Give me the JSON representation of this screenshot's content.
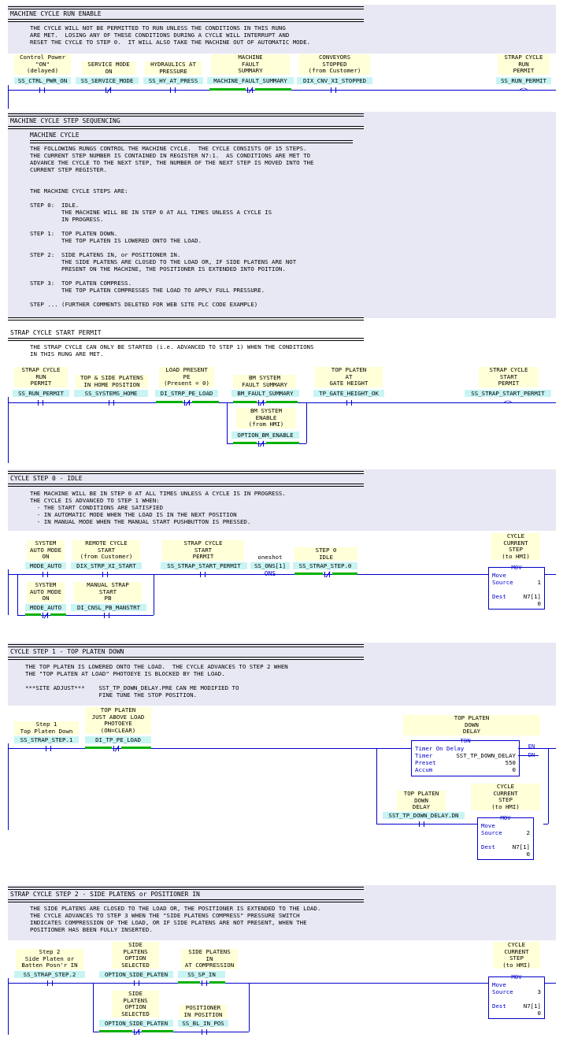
{
  "colors": {
    "wire": "#0000cc",
    "label_bg": "#ffffd8",
    "tag_bg": "#c8f4f4",
    "energized": "#00b000",
    "band": "#e8e8f4"
  },
  "s1": {
    "title": "MACHINE CYCLE RUN ENABLE",
    "comment": "THE CYCLE WILL NOT BE PERMITTED TO RUN UNLESS THE CONDITIONS IN THIS RUNG\nARE MET.  LOSING ANY OF THESE CONDITIONS DURING A CYCLE WILL INTERRUPT AND\nRESET THE CYCLE TO STEP 0.  IT WILL ALSO TAKE THE MACHINE OUT OF AUTOMATIC MODE.",
    "e1": {
      "label": "Control Power\n\"ON\"\n(delayed)",
      "tag": "SS_CTRL_PWR_ON"
    },
    "e2": {
      "label": "SERVICE MODE\nON",
      "tag": "SS_SERVICE_MODE"
    },
    "e3": {
      "label": "HYDRAULICS AT\nPRESSURE",
      "tag": "SS_HY_AT_PRESS"
    },
    "e4": {
      "label": "MACHINE\nFAULT\nSUMMARY",
      "tag": "MACHINE_FAULT_SUMMARY"
    },
    "e5": {
      "label": "CONVEYORS\nSTOPPED\n(from Customer)",
      "tag": "DIX_CNV_XI_STOPPED"
    },
    "out": {
      "label": "STRAP CYCLE\nRUN\nPERMIT",
      "tag": "SS_RUN_PERMIT"
    }
  },
  "s2": {
    "title": "MACHINE CYCLE STEP SEQUENCING",
    "sub": "MACHINE CYCLE",
    "comment": "THE FOLLOWING RUNGS CONTROL THE MACHINE CYCLE.  THE CYCLE CONSISTS OF 15 STEPS.\nTHE CURRENT STEP NUMBER IS CONTAINED IN REGISTER N7:1.  AS CONDITIONS ARE MET TO\nADVANCE THE CYCLE TO THE NEXT STEP, THE NUMBER OF THE NEXT STEP IS MOVED INTO THE\nCURRENT STEP REGISTER.\n\n\nTHE MACHINE CYCLE STEPS ARE:\n\nSTEP 0:  IDLE.\n         THE MACHINE WILL BE IN STEP 0 AT ALL TIMES UNLESS A CYCLE IS\n         IN PROGRESS.\n\nSTEP 1:  TOP PLATEN DOWN.\n         THE TOP PLATEN IS LOWERED ONTO THE LOAD.\n\nSTEP 2:  SIDE PLATENS IN, or POSITIONER IN.\n         THE SIDE PLATENS ARE CLOSED TO THE LOAD OR, IF SIDE PLATENS ARE NOT\n         PRESENT ON THE MACHINE, THE POSITIONER IS EXTENDED INTO POITION.\n\nSTEP 3:  TOP PLATEN COMPRESS.\n         THE TOP PLATEN COMPRESSES THE LOAD TO APPLY FULL PRESSURE.\n\nSTEP ... (FURTHER COMMENTS DELETED FOR WEB SITE PLC CODE EXAMPLE)"
  },
  "s3": {
    "title": "STRAP CYCLE START PERMIT",
    "comment": "THE STRAP CYCLE CAN ONLY BE STARTED (i.e. ADVANCED TO STEP 1) WHEN THE CONDITIONS\nIN THIS RUNG ARE MET.",
    "e1": {
      "label": "STRAP CYCLE\nRUN\nPERMIT",
      "tag": "SS_RUN_PERMIT"
    },
    "e2": {
      "label": "TOP & SIDE PLATENS\nIN HOME POSITION",
      "tag": "SS_SYSTEMS_HOME"
    },
    "e3": {
      "label": "LOAD PRESENT\nPE\n(Present = 0)",
      "tag": "DI_STRP_PE_LOAD"
    },
    "e4": {
      "label": "BM SYSTEM\nFAULT SUMMARY",
      "tag": "BM_FAULT_SUMMARY"
    },
    "e4b": {
      "label": "BM SYSTEM\nENABLE\n(from HMI)",
      "tag": "OPTION_BM_ENABLE"
    },
    "e5": {
      "label": "TOP PLATEN\nAT\nGATE HEIGHT",
      "tag": "TP_GATE_HEIGHT_OK"
    },
    "out": {
      "label": "STRAP CYCLE\nSTART\nPERMIT",
      "tag": "SS_STRAP_START_PERMIT"
    }
  },
  "s4": {
    "title": "CYCLE STEP 0 - IDLE",
    "comment": "THE MACHINE WILL BE IN STEP 0 AT ALL TIMES UNLESS A CYCLE IS IN PROGRESS.\nTHE CYCLE IS ADVANCED TO STEP 1 WHEN:\n  - THE START CONDITIONS ARE SATISFIED\n  - IN AUTOMATIC MODE WHEN THE LOAD IS IN THE NEXT POSITION\n  - IN MANUAL MODE WHEN THE MANUAL START PUSHBUTTON IS PRESSED.",
    "e1": {
      "label": "SYSTEM\nAUTO MODE\nON",
      "tag": "MODE_AUTO"
    },
    "e2": {
      "label": "REMOTE CYCLE\nSTART\n(from Customer)",
      "tag": "DIX_STRP_XI_START"
    },
    "e1b": {
      "label": "SYSTEM\nAUTO MODE\nON",
      "tag": "MODE_AUTO"
    },
    "e2b": {
      "label": "MANUAL STRAP\nSTART\nPB",
      "tag": "DI_CNSL_PB_MANSTRT"
    },
    "e3": {
      "label": "STRAP CYCLE\nSTART\nPERMIT",
      "tag": "SS_STRAP_START_PERMIT"
    },
    "os": {
      "label": "oneshot",
      "tag": "SS_ONS[1]",
      "sym": "ONS"
    },
    "e4": {
      "label": "STEP 0\nIDLE",
      "tag": "SS_STRAP_STEP.0"
    },
    "mov": {
      "label": "CYCLE\nCURRENT\nSTEP\n(to HMI)",
      "hdr": "MOV",
      "move": "Move",
      "src_l": "Source",
      "src_v": "1",
      "dst_l": "Dest",
      "dst_v": "N7[1]",
      "dst_val": "0"
    }
  },
  "s5": {
    "title": "CYCLE STEP 1 - TOP PLATEN DOWN",
    "comment": "THE TOP PLATEN IS LOWERED ONTO THE LOAD.  THE CYCLE ADVANCES TO STEP 2 WHEN\nTHE \"TOP PLATEN AT LOAD\" PHOTOEYE IS BLOCKED BY THE LOAD.\n\n***SITE ADJUST***    SST_TP_DOWN_DELAY.PRE CAN ME MODIFIED TO\n                     FINE TUNE THE STOP POSITION.",
    "e1": {
      "label": "Step 1\nTop Platen Down",
      "tag": "SS_STRAP_STEP.1"
    },
    "e2": {
      "label": "TOP PLATEN\nJUST ABOVE LOAD\nPHOTOEYE\n(ON=CLEAR)",
      "tag": "DI_TP_PE_LOAD"
    },
    "ton": {
      "label": "TOP PLATEN\nDOWN\nDELAY",
      "hdr": "TON",
      "name": "Timer On Delay",
      "t_l": "Timer",
      "t_v": "SST_TP_DOWN_DELAY",
      "p_l": "Preset",
      "p_v": "550",
      "a_l": "Accum",
      "a_v": "0",
      "en": "EN",
      "dn": "DN"
    },
    "e3": {
      "label": "TOP PLATEN\nDOWN\nDELAY",
      "tag": "SST_TP_DOWN_DELAY.DN"
    },
    "mov": {
      "label": "CYCLE\nCURRENT\nSTEP\n(to HMI)",
      "hdr": "MOV",
      "move": "Move",
      "src_l": "Source",
      "src_v": "2",
      "dst_l": "Dest",
      "dst_v": "N7[1]",
      "dst_val": "0"
    }
  },
  "s6": {
    "title": "STRAP CYCLE STEP 2 - SIDE PLATENS or POSITIONER IN",
    "comment": "THE SIDE PLATENS ARE CLOSED TO THE LOAD OR, THE POSITIONER IS EXTENDED TO THE LOAD.\nTHE CYCLE ADVANCES TO STEP 3 WHEN THE \"SIDE PLATENS COMPRESS\" PRESSURE SWITCH\nINDICATES COMPRESSION OF THE LOAD, OR IF SIDE PLATENS ARE NOT PRESENT, WHEN THE\nPOSITIONER HAS BEEN FULLY INSERTED.",
    "e1": {
      "label": "Step 2\nSide Platen or\nBatten Posn'r IN",
      "tag": "SS_STRAP_STEP.2"
    },
    "e2": {
      "label": "SIDE\nPLATENS\nOPTION\nSELECTED",
      "tag": "OPTION_SIDE_PLATEN"
    },
    "e3": {
      "label": "SIDE PLATENS\nIN\nAT COMPRESSION",
      "tag": "SS_SP_IN"
    },
    "e2b": {
      "label": "SIDE\nPLATENS\nOPTION\nSELECTED",
      "tag": "OPTION_SIDE_PLATEN"
    },
    "e3b": {
      "label": "POSITIONER\nIN POSITION",
      "tag": "SS_BL_IN_POS"
    },
    "mov": {
      "label": "CYCLE\nCURRENT\nSTEP\n(to HMI)",
      "hdr": "MOV",
      "move": "Move",
      "src_l": "Source",
      "src_v": "3",
      "dst_l": "Dest",
      "dst_v": "N7[1]",
      "dst_val": "0"
    }
  }
}
